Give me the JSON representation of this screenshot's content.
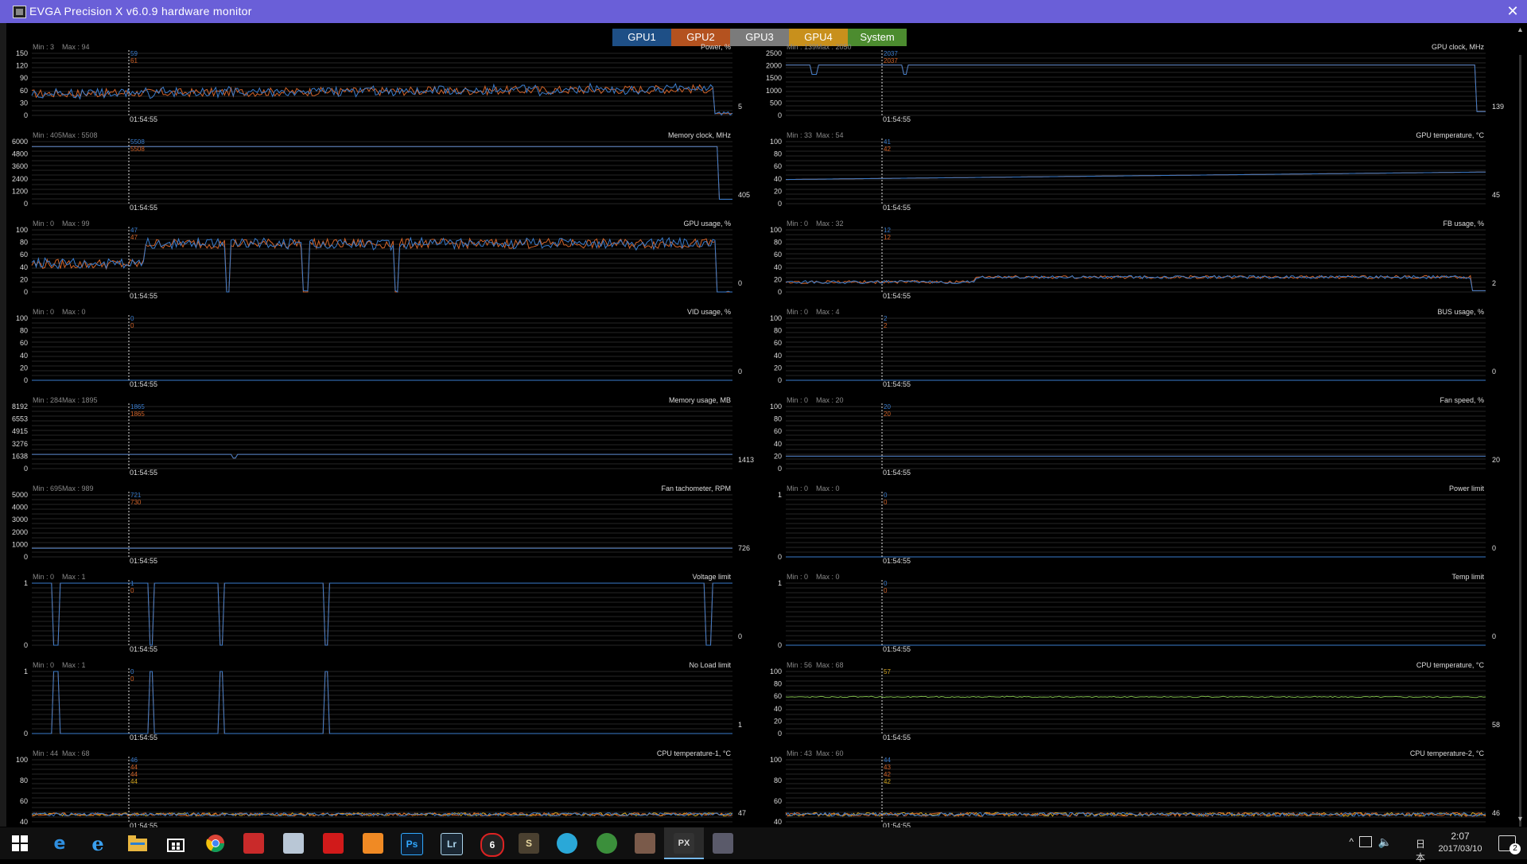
{
  "window": {
    "title": "EVGA Precision X v6.0.9 hardware monitor",
    "close_label": "✕"
  },
  "tabs": [
    {
      "label": "GPU1",
      "color": "#1e4f86"
    },
    {
      "label": "GPU2",
      "color": "#b4521f"
    },
    {
      "label": "GPU3",
      "color": "#7b7b7b"
    },
    {
      "label": "GPU4",
      "color": "#c8901c"
    },
    {
      "label": "System",
      "color": "#4c8c2f"
    }
  ],
  "colors": {
    "gpu1": "#3a7ccc",
    "gpu2": "#d2642a",
    "gpu3": "#bbbbbb",
    "gpu4": "#d4a620",
    "system": "#7ab648",
    "grid": "#262626"
  },
  "time_marker": "01:54:55",
  "graphs": {
    "left": [
      {
        "title": "Power, %",
        "min": "Min : 3",
        "max": "Max : 94",
        "ticks": [
          "150",
          "120",
          "90",
          "60",
          "30",
          "0"
        ],
        "cursor_values": [
          "59",
          "61"
        ],
        "current": "5"
      },
      {
        "title": "Memory clock, MHz",
        "min": "Min : 405",
        "max": "Max : 5508",
        "ticks": [
          "6000",
          "4800",
          "3600",
          "2400",
          "1200",
          "0"
        ],
        "cursor_values": [
          "5508",
          "5508"
        ],
        "current": "405"
      },
      {
        "title": "GPU usage, %",
        "min": "Min : 0",
        "max": "Max : 99",
        "ticks": [
          "100",
          "80",
          "60",
          "40",
          "20",
          "0"
        ],
        "cursor_values": [
          "47",
          "47"
        ],
        "current": "0"
      },
      {
        "title": "VID usage, %",
        "min": "Min : 0",
        "max": "Max : 0",
        "ticks": [
          "100",
          "80",
          "60",
          "40",
          "20",
          "0"
        ],
        "cursor_values": [
          "0",
          "0"
        ],
        "current": "0"
      },
      {
        "title": "Memory usage, MB",
        "min": "Min : 284",
        "max": "Max : 1895",
        "ticks": [
          "8192",
          "6553",
          "4915",
          "3276",
          "1638",
          "0"
        ],
        "cursor_values": [
          "1865",
          "1865"
        ],
        "current": "1413"
      },
      {
        "title": "Fan tachometer, RPM",
        "min": "Min : 695",
        "max": "Max : 989",
        "ticks": [
          "5000",
          "4000",
          "3000",
          "2000",
          "1000",
          "0"
        ],
        "cursor_values": [
          "721",
          "730"
        ],
        "current": "726"
      },
      {
        "title": "Voltage limit",
        "min": "Min : 0",
        "max": "Max : 1",
        "ticks": [
          "1",
          "0"
        ],
        "cursor_values": [
          "1",
          "0"
        ],
        "current": "0"
      },
      {
        "title": "No Load limit",
        "min": "Min : 0",
        "max": "Max : 1",
        "ticks": [
          "1",
          "0"
        ],
        "cursor_values": [
          "0",
          "0"
        ],
        "current": "1"
      },
      {
        "title": "CPU temperature-1, °C",
        "min": "Min : 44",
        "max": "Max : 68",
        "ticks": [
          "100",
          "80",
          "60",
          "40"
        ],
        "cursor_values": [
          "46",
          "44",
          "44",
          "44"
        ],
        "current": "47"
      }
    ],
    "right": [
      {
        "title": "GPU clock, MHz",
        "min": "Min : 139",
        "max": "Max : 2050",
        "ticks": [
          "2500",
          "2000",
          "1500",
          "1000",
          "500",
          "0"
        ],
        "cursor_values": [
          "2037",
          "2037"
        ],
        "current": "139"
      },
      {
        "title": "GPU temperature, °C",
        "min": "Min : 33",
        "max": "Max : 54",
        "ticks": [
          "100",
          "80",
          "60",
          "40",
          "20",
          "0"
        ],
        "cursor_values": [
          "41",
          "42"
        ],
        "current": "45"
      },
      {
        "title": "FB usage, %",
        "min": "Min : 0",
        "max": "Max : 32",
        "ticks": [
          "100",
          "80",
          "60",
          "40",
          "20",
          "0"
        ],
        "cursor_values": [
          "12",
          "12"
        ],
        "current": "2"
      },
      {
        "title": "BUS usage, %",
        "min": "Min : 0",
        "max": "Max : 4",
        "ticks": [
          "100",
          "80",
          "60",
          "40",
          "20",
          "0"
        ],
        "cursor_values": [
          "2",
          "2"
        ],
        "current": "0"
      },
      {
        "title": "Fan speed, %",
        "min": "Min : 0",
        "max": "Max : 20",
        "ticks": [
          "100",
          "80",
          "60",
          "40",
          "20",
          "0"
        ],
        "cursor_values": [
          "20",
          "20"
        ],
        "current": "20"
      },
      {
        "title": "Power limit",
        "min": "Min : 0",
        "max": "Max : 0",
        "ticks": [
          "1",
          "0"
        ],
        "cursor_values": [
          "0",
          "0"
        ],
        "current": "0"
      },
      {
        "title": "Temp limit",
        "min": "Min : 0",
        "max": "Max : 0",
        "ticks": [
          "1",
          "0"
        ],
        "cursor_values": [
          "0",
          "0"
        ],
        "current": "0"
      },
      {
        "title": "CPU temperature, °C",
        "min": "Min : 56",
        "max": "Max : 68",
        "ticks": [
          "100",
          "80",
          "60",
          "40",
          "20",
          "0"
        ],
        "cursor_values": [
          "57"
        ],
        "current": "58"
      },
      {
        "title": "CPU temperature-2, °C",
        "min": "Min : 43",
        "max": "Max : 60",
        "ticks": [
          "100",
          "80",
          "60",
          "40"
        ],
        "cursor_values": [
          "44",
          "43",
          "42",
          "42"
        ],
        "current": "46"
      }
    ]
  },
  "taskbar": {
    "icons": [
      "windows-start-icon",
      "edge-icon",
      "internet-explorer-icon",
      "file-explorer-icon",
      "store-icon",
      "chrome-icon",
      "app-red-icon",
      "app-notes-icon",
      "app-red2-icon",
      "camera-app-icon",
      "photoshop-icon",
      "lightroom-icon",
      "app-6-icon",
      "app-s-icon",
      "app-globe-icon",
      "app-map-icon",
      "app-avatar-icon",
      "precision-x-icon",
      "app-monitor-icon"
    ],
    "ps_label": "Ps",
    "lr_label": "Lr",
    "six_label": "6",
    "s_label": "S",
    "px_label": "PX",
    "tray_chevron": "^",
    "ime_label": "日本",
    "time": "2:07",
    "date": "2017/03/10",
    "notification_count": "2"
  }
}
